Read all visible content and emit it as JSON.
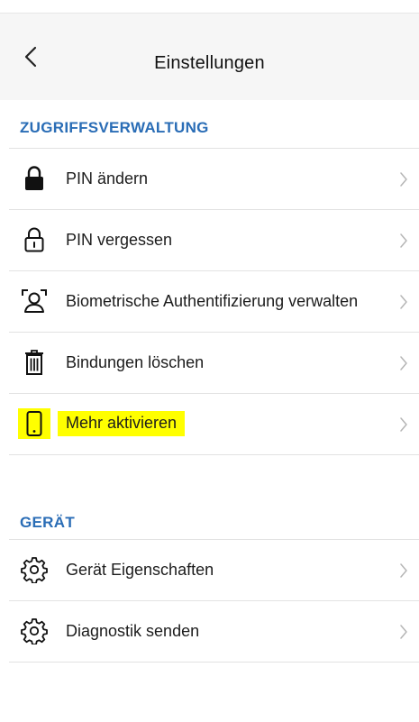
{
  "header": {
    "title": "Einstellungen"
  },
  "sections": [
    {
      "title": "ZUGRIFFSVERWALTUNG",
      "items": [
        {
          "label": "PIN ändern",
          "icon": "lock-closed-icon"
        },
        {
          "label": "PIN vergessen",
          "icon": "lock-open-icon"
        },
        {
          "label": "Biometrische Authentifizierung verwalten",
          "icon": "face-scan-icon"
        },
        {
          "label": "Bindungen löschen",
          "icon": "trash-icon"
        },
        {
          "label": "Mehr aktivieren",
          "icon": "phone-icon",
          "highlight": "#ffff00"
        }
      ]
    },
    {
      "title": "GERÄT",
      "items": [
        {
          "label": "Gerät Eigenschaften",
          "icon": "gear-icon"
        },
        {
          "label": "Diagnostik senden",
          "icon": "gear-icon"
        }
      ]
    }
  ],
  "colors": {
    "accent": "#2a6db6",
    "highlight": "#ffff00",
    "divider": "#e2e2e2"
  }
}
